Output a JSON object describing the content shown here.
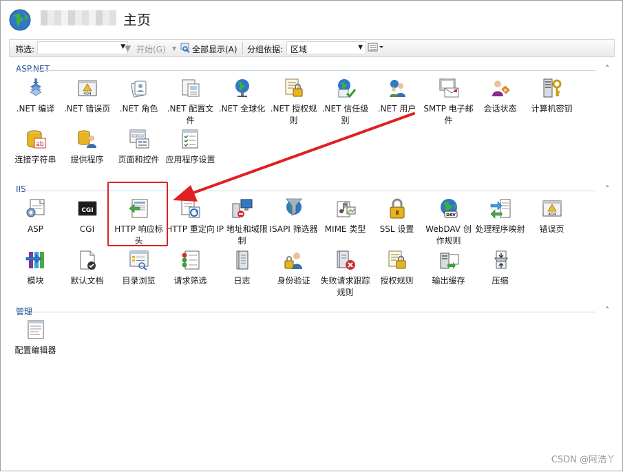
{
  "header": {
    "title": "主页"
  },
  "toolbar": {
    "filter_label": "筛选:",
    "start_label": "开始(G)",
    "show_all_label": "全部显示(A)",
    "group_by_label": "分组依据:",
    "group_by_value": "区域"
  },
  "sections": [
    {
      "label": "ASP.NET",
      "items": [
        {
          "label": ".NET 编译",
          "icon": "compile-icon"
        },
        {
          "label": ".NET 错误页",
          "icon": "error-page-icon"
        },
        {
          "label": ".NET 角色",
          "icon": "roles-icon"
        },
        {
          "label": ".NET 配置文件",
          "icon": "profile-icon"
        },
        {
          "label": ".NET 全球化",
          "icon": "globalization-icon"
        },
        {
          "label": ".NET 授权规则",
          "icon": "authorization-icon"
        },
        {
          "label": ".NET 信任级别",
          "icon": "trust-icon"
        },
        {
          "label": ".NET 用户",
          "icon": "users-icon"
        },
        {
          "label": "SMTP 电子邮件",
          "icon": "smtp-icon"
        },
        {
          "label": "会话状态",
          "icon": "session-icon"
        },
        {
          "label": "计算机密钥",
          "icon": "machine-key-icon"
        },
        {
          "label": "连接字符串",
          "icon": "connection-string-icon"
        },
        {
          "label": "提供程序",
          "icon": "providers-icon"
        },
        {
          "label": "页面和控件",
          "icon": "pages-controls-icon"
        },
        {
          "label": "应用程序设置",
          "icon": "app-settings-icon"
        }
      ]
    },
    {
      "label": "IIS",
      "items": [
        {
          "label": "ASP",
          "icon": "asp-icon"
        },
        {
          "label": "CGI",
          "icon": "cgi-icon"
        },
        {
          "label": "HTTP 响应标头",
          "icon": "http-headers-icon"
        },
        {
          "label": "HTTP 重定向",
          "icon": "redirect-icon"
        },
        {
          "label": "IP 地址和域限制",
          "icon": "ip-restrict-icon"
        },
        {
          "label": "ISAPI 筛选器",
          "icon": "isapi-icon"
        },
        {
          "label": "MIME 类型",
          "icon": "mime-icon"
        },
        {
          "label": "SSL 设置",
          "icon": "ssl-lock-icon"
        },
        {
          "label": "WebDAV 创作规则",
          "icon": "webdav-icon"
        },
        {
          "label": "处理程序映射",
          "icon": "handler-icon"
        },
        {
          "label": "错误页",
          "icon": "error-page-icon"
        },
        {
          "label": "模块",
          "icon": "modules-icon"
        },
        {
          "label": "默认文档",
          "icon": "default-doc-icon"
        },
        {
          "label": "目录浏览",
          "icon": "dir-browse-icon"
        },
        {
          "label": "请求筛选",
          "icon": "request-filter-icon"
        },
        {
          "label": "日志",
          "icon": "logging-icon"
        },
        {
          "label": "身份验证",
          "icon": "authentication-icon"
        },
        {
          "label": "失败请求跟踪规则",
          "icon": "failed-request-icon"
        },
        {
          "label": "授权规则",
          "icon": "authorization-icon"
        },
        {
          "label": "输出缓存",
          "icon": "output-cache-icon"
        },
        {
          "label": "压缩",
          "icon": "compression-icon"
        }
      ]
    },
    {
      "label": "管理",
      "items": [
        {
          "label": "配置编辑器",
          "icon": "config-editor-icon"
        }
      ]
    }
  ],
  "watermark": "CSDN @阿浩丫",
  "colors": {
    "section_label": "#1f4f8c",
    "highlight": "#e02020"
  }
}
